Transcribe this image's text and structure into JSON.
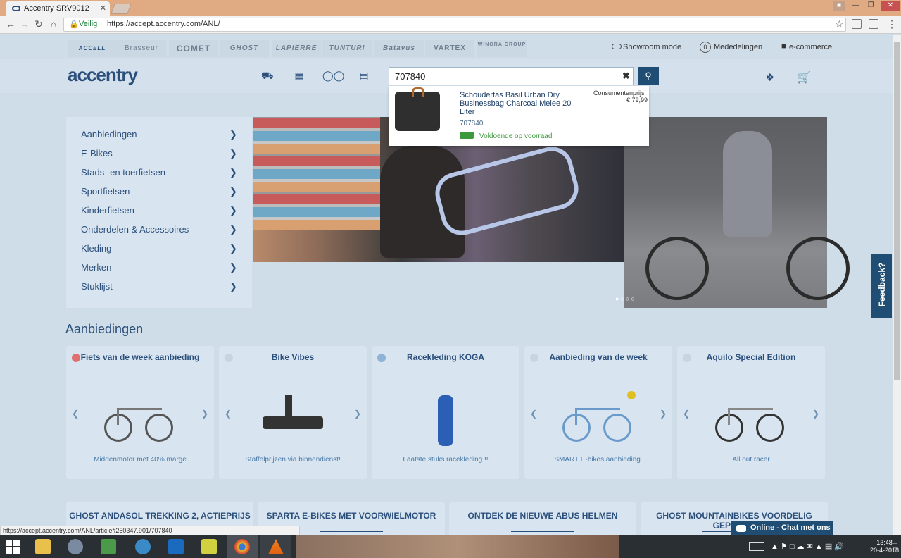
{
  "browser": {
    "tab_title": "Accentry SRV9012",
    "tab_close": "✕",
    "secure_label": "Veilig",
    "url": "https://accept.accentry.com/ANL/",
    "status_url": "https://accept.accentry.com/ANL/article#250347.901/707840"
  },
  "brands": [
    "ACCELL",
    "Brasseur",
    "COMET",
    "GHOST",
    "LAPIERRE",
    "TUNTURI",
    "Batavus",
    "VARTEX",
    "WINORA GROUP"
  ],
  "toplinks": {
    "showroom": "Showroom mode",
    "messages_count": "0",
    "messages": "Mededelingen",
    "ecommerce": "e-commerce"
  },
  "header": {
    "logo": "accentry",
    "search_value": "707840"
  },
  "suggestion": {
    "name": "Schoudertas Basil Urban Dry Businessbag Charcoal Melee 20 Liter",
    "code": "707840",
    "stock": "Voldoende op voorraad",
    "price_label": "Consumentenprijs",
    "price": "€ 79,99"
  },
  "sidebar": {
    "items": [
      {
        "label": "Aanbiedingen"
      },
      {
        "label": "E-Bikes"
      },
      {
        "label": "Stads- en toerfietsen"
      },
      {
        "label": "Sportfietsen"
      },
      {
        "label": "Kinderfietsen"
      },
      {
        "label": "Onderdelen & Accessoires"
      },
      {
        "label": "Kleding"
      },
      {
        "label": "Merken"
      },
      {
        "label": "Stuklijst"
      }
    ]
  },
  "section_title": "Aanbiedingen",
  "cards": [
    {
      "title": "Fiets van de week aanbieding",
      "caption": "Middenmotor met 40% marge"
    },
    {
      "title": "Bike Vibes",
      "caption": "Staffelprijzen via binnendienst!"
    },
    {
      "title": "Racekleding KOGA",
      "caption": "Laatste stuks racekleding !!"
    },
    {
      "title": "Aanbieding van de week",
      "caption": "SMART E-bikes aanbieding."
    },
    {
      "title": "Aquilo Special Edition",
      "caption": "All out racer"
    }
  ],
  "cards2": [
    {
      "title": "GHOST ANDASOL TREKKING 2, ACTIEPRIJS"
    },
    {
      "title": "SPARTA E-BIKES MET VOORWIELMOTOR"
    },
    {
      "title": "ONTDEK DE NIEUWE ABUS HELMEN"
    },
    {
      "title": "GHOST MOUNTAINBIKES VOORDELIG GEPRIJSD"
    }
  ],
  "feedback": "Feedback?",
  "chat": "Online - Chat met ons",
  "taskbar": {
    "time": "13:48",
    "date": "20-4-2018"
  }
}
